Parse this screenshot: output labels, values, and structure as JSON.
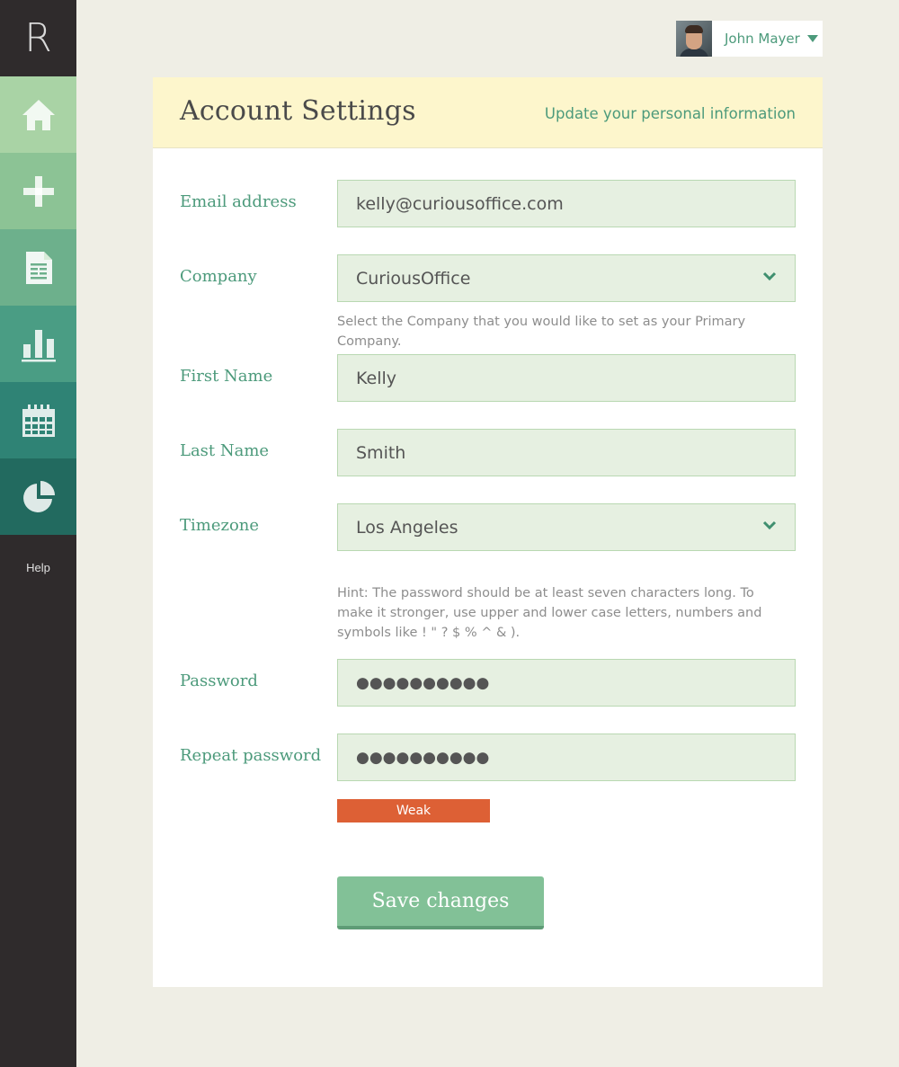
{
  "app": {
    "logo_text": "R",
    "help_label": "Help"
  },
  "sidebar": {
    "items": [
      {
        "icon": "home-icon",
        "color": "#a9d3a5"
      },
      {
        "icon": "plus-icon",
        "color": "#8cc395"
      },
      {
        "icon": "document-icon",
        "color": "#6db08c"
      },
      {
        "icon": "bar-chart-icon",
        "color": "#4a9d84"
      },
      {
        "icon": "calendar-icon",
        "color": "#2f8375"
      },
      {
        "icon": "pie-chart-icon",
        "color": "#226a5f"
      }
    ]
  },
  "user": {
    "name": "John Mayer"
  },
  "header": {
    "title": "Account Settings",
    "subtitle": "Update your personal information"
  },
  "form": {
    "email": {
      "label": "Email address",
      "value": "kelly@curiousoffice.com"
    },
    "company": {
      "label": "Company",
      "value": "CuriousOffice",
      "help": "Select the Company that you would like to set as your Primary Company."
    },
    "first_name": {
      "label": "First Name",
      "value": "Kelly"
    },
    "last_name": {
      "label": "Last Name",
      "value": "Smith"
    },
    "timezone": {
      "label": "Timezone",
      "value": "Los Angeles"
    },
    "password_hint": "Hint: The password should be at least seven characters long. To make it stronger, use upper and lower case letters, numbers and symbols like ! \" ? $ % ^ & ).",
    "password": {
      "label": "Password",
      "value": "●●●●●●●●●●"
    },
    "repeat_password": {
      "label": "Repeat password",
      "value": "●●●●●●●●●●"
    },
    "strength": {
      "label": "Weak",
      "color": "#dd6035"
    },
    "save_label": "Save changes"
  }
}
